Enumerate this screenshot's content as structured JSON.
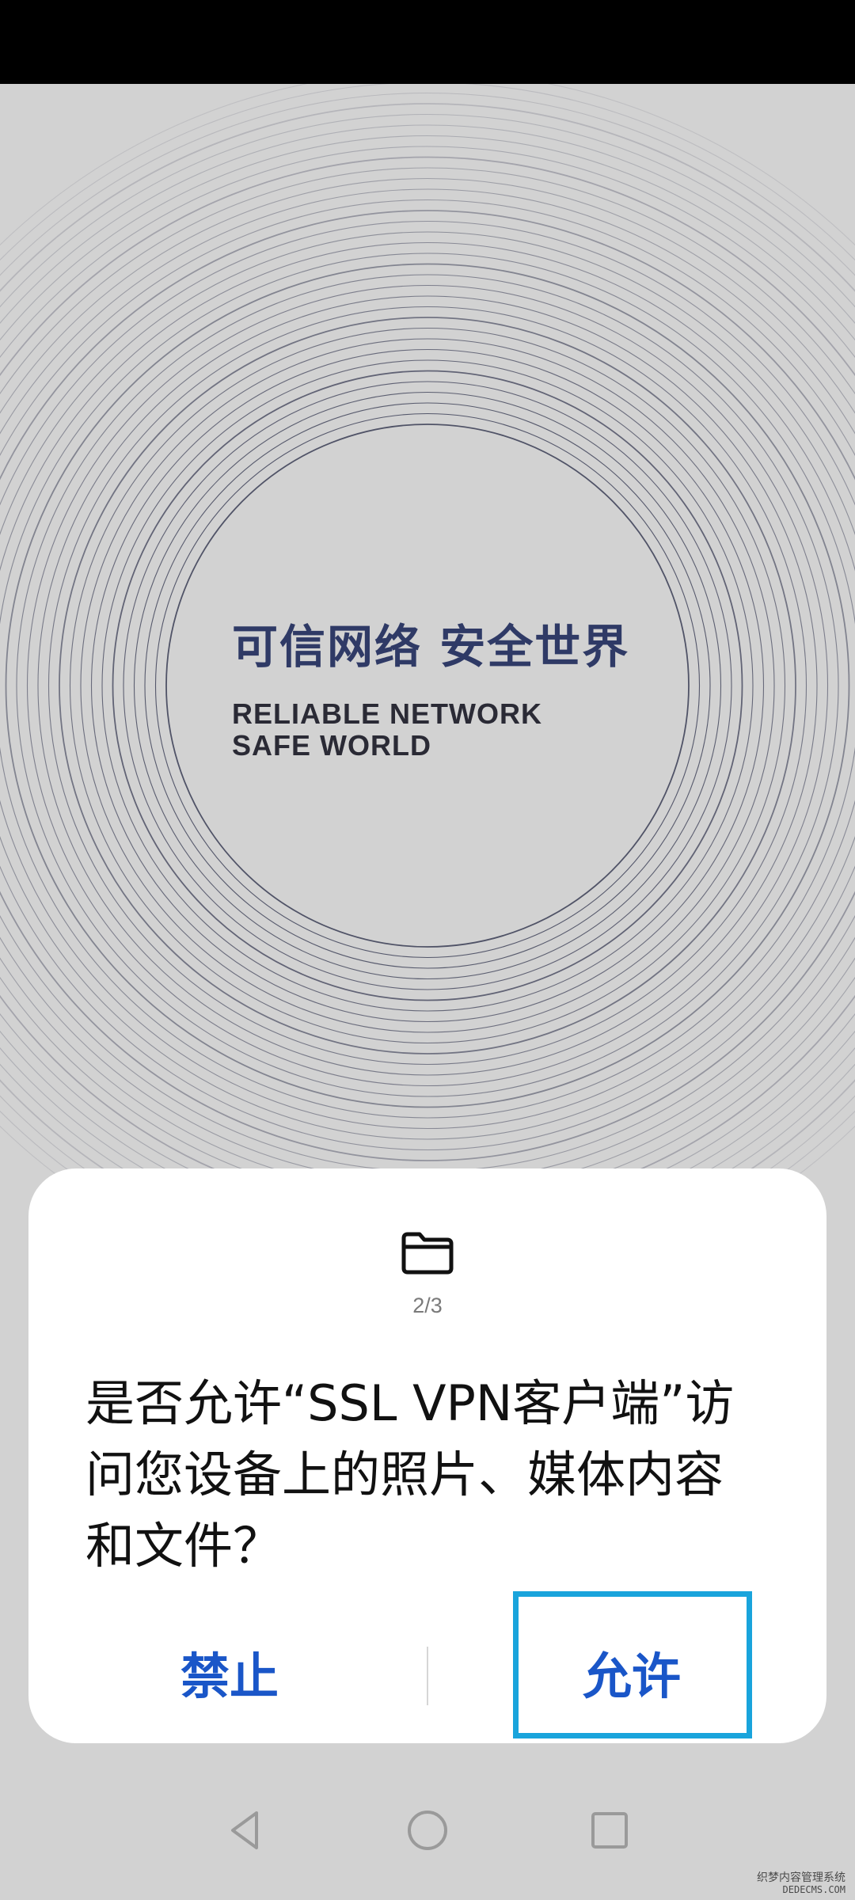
{
  "splash": {
    "slogan_cn": "可信网络  安全世界",
    "slogan_en_line1": "RELIABLE NETWORK",
    "slogan_en_line2": "SAFE WORLD"
  },
  "dialog": {
    "icon": "folder-icon",
    "step": "2/3",
    "message": "是否允许“SSL VPN客户端”访问您设备上的照片、媒体内容和文件？",
    "deny_label": "禁止",
    "allow_label": "允许"
  },
  "navbar": {
    "back_icon": "back-triangle-icon",
    "home_icon": "home-circle-icon",
    "recents_icon": "recents-square-icon"
  },
  "watermark": {
    "line1": "织梦内容管理系统",
    "line2": "DEDECMS.COM"
  },
  "colors": {
    "status_bar": "#000000",
    "background": "#d2d2d2",
    "dialog_bg": "#ffffff",
    "button_text": "#1a56c8",
    "highlight_border": "#19a4dc",
    "slogan_cn": "#2f3a66"
  }
}
